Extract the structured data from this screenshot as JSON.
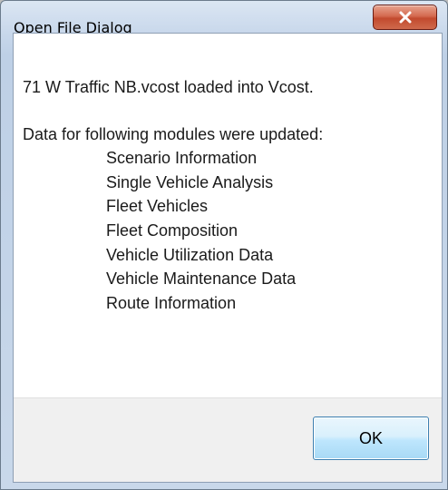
{
  "window": {
    "title": "Open File Dialog"
  },
  "message": {
    "loaded_line": "71 W Traffic NB.vcost loaded into Vcost.",
    "updated_line": "Data for following modules were updated:",
    "modules": [
      "Scenario Information",
      "Single Vehicle Analysis",
      "Fleet Vehicles",
      "Fleet Composition",
      "Vehicle Utilization Data",
      "Vehicle Maintenance Data",
      "Route Information"
    ]
  },
  "buttons": {
    "ok_label": "OK",
    "close_icon": "close-icon"
  },
  "colors": {
    "title_bar": "#c6d6ea",
    "close_button": "#c24a2e",
    "ok_button": "#bee6fd",
    "footer": "#f0f0f0"
  }
}
